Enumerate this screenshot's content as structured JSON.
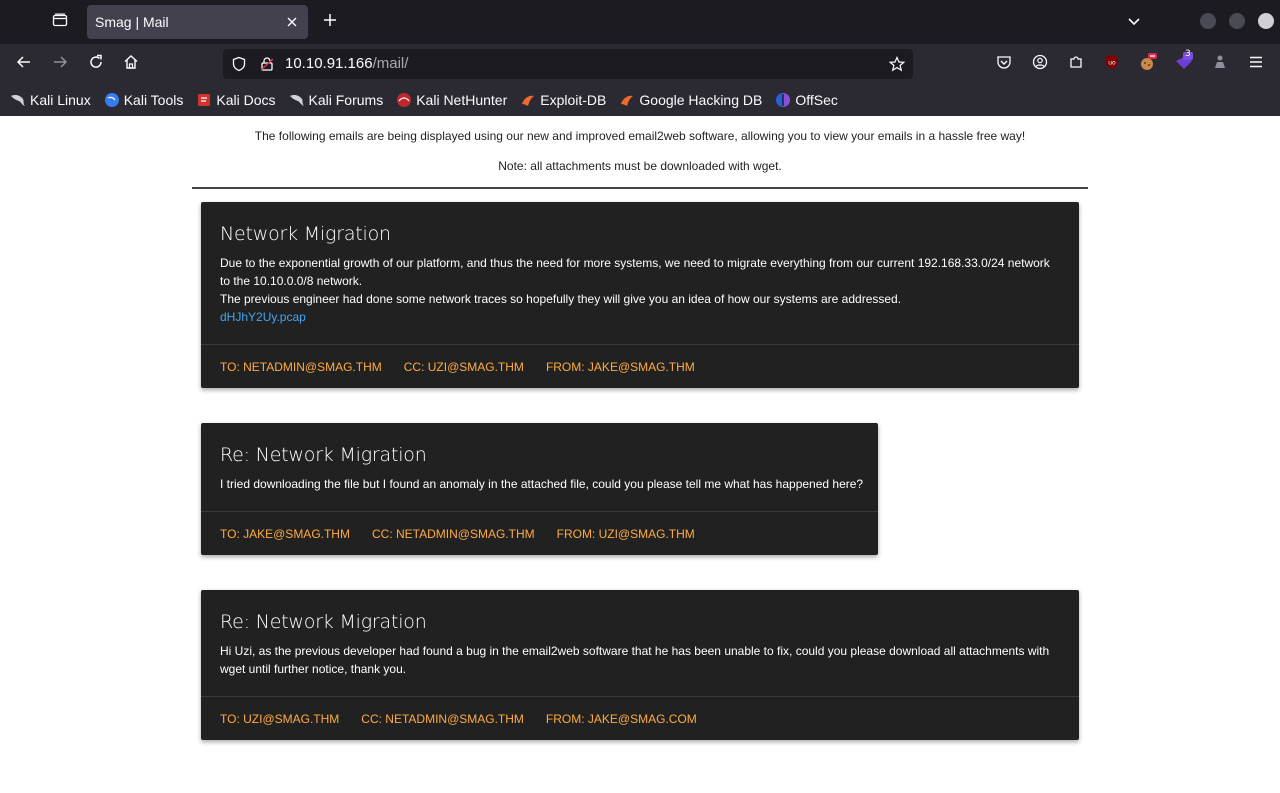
{
  "browser": {
    "tab_title": "Smag | Mail",
    "url_host": "10.10.91.166",
    "url_path": "/mail/",
    "bookmarks": [
      {
        "label": "Kali Linux",
        "icon": "kali-dragon-icon"
      },
      {
        "label": "Kali Tools",
        "icon": "kali-tools-icon"
      },
      {
        "label": "Kali Docs",
        "icon": "kali-docs-icon"
      },
      {
        "label": "Kali Forums",
        "icon": "kali-dragon-icon"
      },
      {
        "label": "Kali NetHunter",
        "icon": "nethunter-icon"
      },
      {
        "label": "Exploit-DB",
        "icon": "exploit-db-icon"
      },
      {
        "label": "Google Hacking DB",
        "icon": "ghdb-icon"
      },
      {
        "label": "OffSec",
        "icon": "offsec-icon"
      }
    ],
    "extension_badge": "3"
  },
  "page": {
    "intro": "The following emails are being displayed using our new and improved email2web software, allowing you to view your emails in a hassle free way!",
    "note": "Note: all attachments must be downloaded with wget."
  },
  "emails": [
    {
      "title": "Network Migration",
      "lines": [
        "Due to the exponential growth of our platform, and thus the need for more systems, we need to migrate everything from our current 192.168.33.0/24 network",
        "to the 10.10.0.0/8 network.",
        "The previous engineer had done some network traces so hopefully they will give you an idea of how our systems are addressed."
      ],
      "attachment": "dHJhY2Uy.pcap",
      "to": "To: netadmin@smag.thm",
      "cc": "CC: uzi@smag.thm",
      "from": "From: jake@smag.thm"
    },
    {
      "title": "Re: Network Migration",
      "lines": [
        "I tried downloading the file but I found an anomaly in the attached file, could you please tell me what has happened here?"
      ],
      "to": "To: jake@smag.thm",
      "cc": "CC: netadmin@smag.thm",
      "from": "From: uzi@smag.thm"
    },
    {
      "title": "Re: Network Migration",
      "lines": [
        "Hi Uzi, as the previous developer had found a bug in the email2web software that he has been unable to fix, could you please download all attachments with",
        "wget until further notice, thank you."
      ],
      "to": "To: uzi@smag.thm",
      "cc": "CC: netadmin@smag.thm",
      "from": "From: jake@smag.com"
    }
  ],
  "colors": {
    "card_bg": "#212121",
    "link": "#42a5f5",
    "action": "#ffab40"
  }
}
